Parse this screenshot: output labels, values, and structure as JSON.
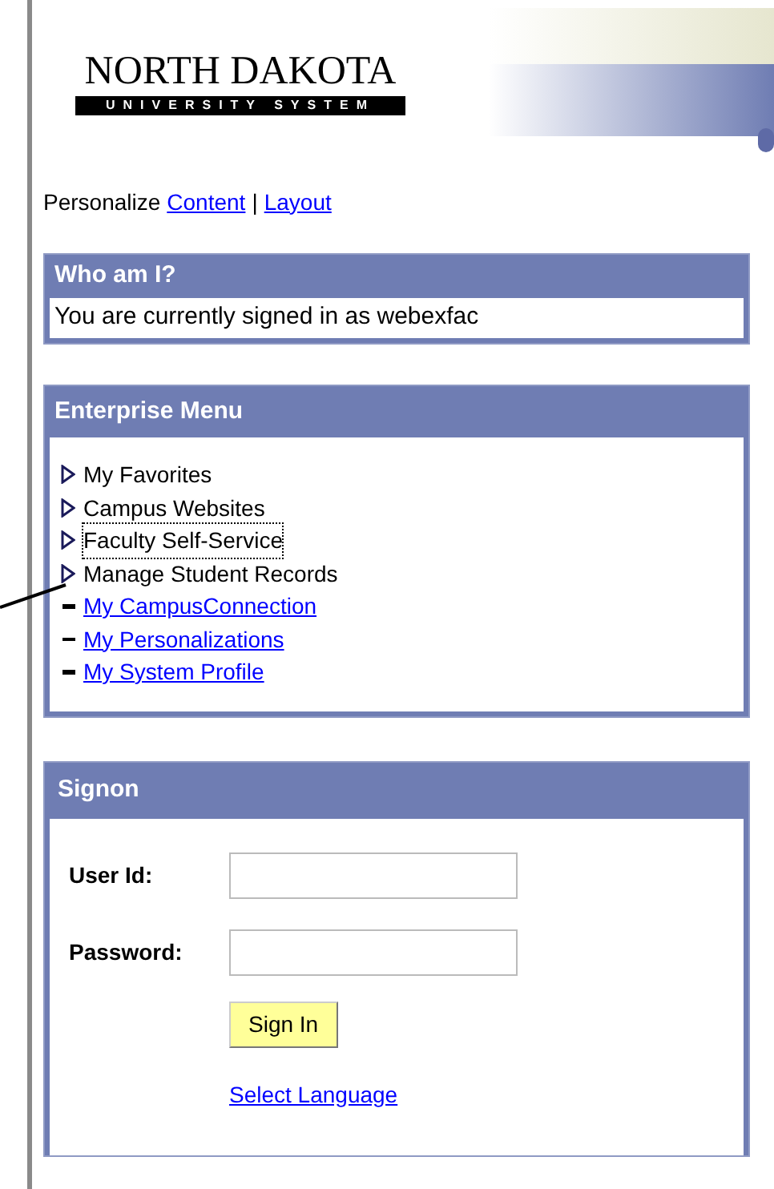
{
  "logo": {
    "title": "NORTH DAKOTA",
    "subtitle": "UNIVERSITY SYSTEM"
  },
  "personalize": {
    "label": "Personalize",
    "links": [
      "Content",
      "Layout"
    ],
    "separator": "|"
  },
  "who_am_i": {
    "title": "Who am I?",
    "text": "You are currently signed in as webexfac"
  },
  "enterprise_menu": {
    "title": "Enterprise Menu",
    "items": [
      {
        "kind": "folder",
        "label": "My Favorites",
        "focused": false
      },
      {
        "kind": "folder",
        "label": "Campus Websites",
        "focused": false
      },
      {
        "kind": "folder",
        "label": "Faculty Self-Service",
        "focused": true
      },
      {
        "kind": "folder",
        "label": "Manage Student Records",
        "focused": false
      },
      {
        "kind": "link",
        "label": "My CampusConnection",
        "focused": false
      },
      {
        "kind": "link",
        "label": "My Personalizations",
        "focused": false
      },
      {
        "kind": "link",
        "label": "My System Profile",
        "focused": false
      }
    ]
  },
  "signon": {
    "title": "Signon",
    "fields": [
      {
        "label": "User Id:"
      },
      {
        "label": "Password:"
      }
    ],
    "button": "Sign In",
    "link": "Select Language"
  }
}
